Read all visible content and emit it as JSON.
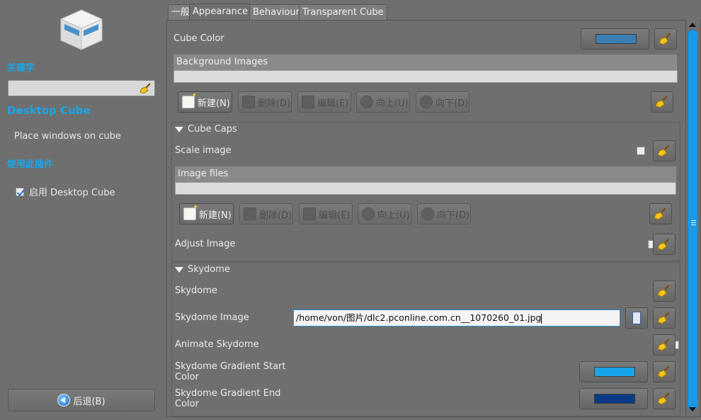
{
  "left": {
    "keyword_heading": "关键字",
    "plugin_title": "Desktop Cube",
    "plugin_desc": "Place windows on cube",
    "use_plugin_heading": "使用此插件",
    "enable_label": "启用 Desktop Cube",
    "enable_checked": true,
    "back_label": "后退(B)"
  },
  "tabs": [
    {
      "label": "一般",
      "active": false
    },
    {
      "label": "Appearance",
      "active": true
    },
    {
      "label": "Behaviour",
      "active": false
    },
    {
      "label": "Transparent Cube",
      "active": false
    }
  ],
  "appearance": {
    "cube_color_label": "Cube Color",
    "cube_color": "#3b7fb4",
    "bg_images_header": "Background Images",
    "buttons": {
      "new": "新建(N)",
      "delete": "删除(D)",
      "edit": "编辑(E)",
      "up": "向上(U)",
      "down": "向下(D)"
    },
    "cube_caps": {
      "title": "Cube Caps",
      "scale_image_label": "Scale image",
      "scale_image_checked": false,
      "image_files_header": "Image files",
      "adjust_image_label": "Adjust Image",
      "adjust_image_checked": false
    },
    "skydome": {
      "title": "Skydome",
      "skydome_label": "Skydome",
      "skydome_checked": true,
      "image_label": "Skydome Image",
      "image_value": "/home/von/图片/dlc2.pconline.com.cn__1070260_01.jpg",
      "animate_label": "Animate Skydome",
      "animate_checked": false,
      "grad_start_label_1": "Skydome Gradient Start",
      "grad_start_label_2": "Color",
      "grad_start_color": "#17a6ec",
      "grad_end_label_1": "Skydome Gradient End",
      "grad_end_label_2": "Color",
      "grad_end_color": "#0a3a85"
    }
  }
}
